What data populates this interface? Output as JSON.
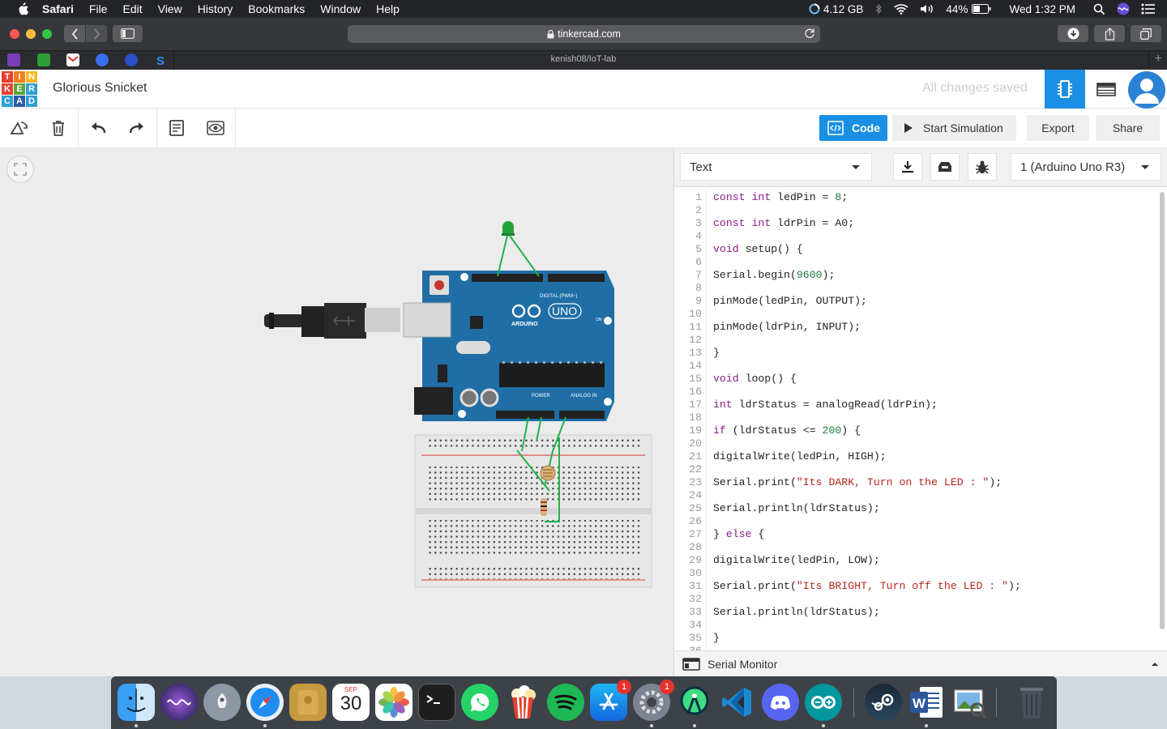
{
  "menubar": {
    "app": "Safari",
    "items": [
      "File",
      "Edit",
      "View",
      "History",
      "Bookmarks",
      "Window",
      "Help"
    ],
    "memory": "4.12 GB",
    "battery": "44%",
    "clock": "Wed 1:32 PM"
  },
  "browser": {
    "url": "tinkercad.com",
    "tab_title": "kenish08/IoT-lab"
  },
  "header": {
    "logo_letters": [
      "T",
      "I",
      "N",
      "K",
      "E",
      "R",
      "C",
      "A",
      "D"
    ],
    "design_name": "Glorious Snicket",
    "save_status": "All changes saved"
  },
  "toolbar": {
    "code_label": "Code",
    "simulate_label": "Start Simulation",
    "export_label": "Export",
    "share_label": "Share"
  },
  "code_panel": {
    "mode": "Text",
    "device": "1 (Arduino Uno R3)",
    "serial_monitor_label": "Serial Monitor",
    "lines": [
      "const int ledPin = 8;",
      "",
      "const int ldrPin = A0;",
      "",
      "void setup() {",
      "",
      "Serial.begin(9600);",
      "",
      "pinMode(ledPin, OUTPUT);",
      "",
      "pinMode(ldrPin, INPUT);",
      "",
      "}",
      "",
      "void loop() {",
      "",
      "int ldrStatus = analogRead(ldrPin);",
      "",
      "if (ldrStatus <= 200) {",
      "",
      "digitalWrite(ledPin, HIGH);",
      "",
      "Serial.print(\"Its DARK, Turn on the LED : \");",
      "",
      "Serial.println(ldrStatus);",
      "",
      "} else {",
      "",
      "digitalWrite(ledPin, LOW);",
      "",
      "Serial.print(\"Its BRIGHT, Turn off the LED : \");",
      "",
      "Serial.println(ldrStatus);",
      "",
      "}",
      ""
    ]
  },
  "board": {
    "logo_text": "ARDUINO",
    "model": "UNO",
    "digital_label": "DIGITAL (PWM~)",
    "power_label": "POWER",
    "analog_label": "ANALOG IN",
    "on_label": "ON"
  },
  "dock": {
    "calendar_month": "SEP",
    "calendar_day": "30",
    "badges": [
      "1",
      "1"
    ],
    "apps": [
      "finder-icon",
      "siri-icon",
      "launchpad-icon",
      "safari-icon",
      "notes-icon",
      "calendar-icon",
      "photos-icon",
      "terminal-icon",
      "whatsapp-icon",
      "popcorn-time-icon",
      "spotify-icon",
      "app-store-icon",
      "system-preferences-icon",
      "android-studio-icon",
      "vscode-icon",
      "discord-icon",
      "arduino-icon",
      "steam-icon",
      "word-icon",
      "preview-icon",
      "trash-icon"
    ]
  },
  "colors": {
    "accent": "#1a8fe3",
    "board": "#1f6ea6",
    "led": "#23a33b",
    "wire": "#22b14c"
  }
}
